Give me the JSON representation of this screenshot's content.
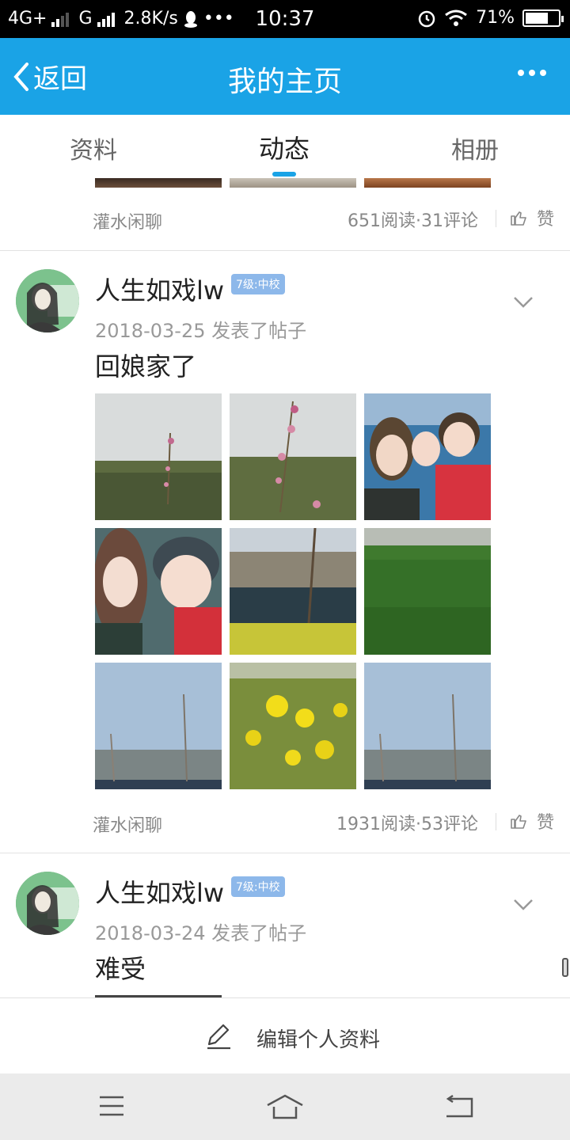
{
  "status_bar": {
    "network_1": "4G+",
    "network_2": "G",
    "speed": "2.8K/s",
    "overflow": "•••",
    "time": "10:37",
    "battery": "71%",
    "battery_level": 0.71,
    "icons": [
      "signal-icon",
      "qq-penguin-icon",
      "alarm-icon",
      "wifi-icon",
      "battery-icon"
    ]
  },
  "header": {
    "back_label": "返回",
    "title": "我的主页",
    "more_icon": "more-dots-icon"
  },
  "tabs": [
    {
      "label": "资料",
      "active": false
    },
    {
      "label": "动态",
      "active": true
    },
    {
      "label": "相册",
      "active": false
    }
  ],
  "feed": {
    "previous_post": {
      "category": "灌水闲聊",
      "stats": "651阅读·31评论",
      "like_label": "赞"
    },
    "posts": [
      {
        "author": "人生如戏lw",
        "level": "7级:中校",
        "date": "2018-03-25 发表了帖子",
        "text": "回娘家了",
        "images": [
          "magnolia-field",
          "magnolia-field",
          "selfie-family",
          "selfie-two",
          "river-trees",
          "green-field",
          "sky-trees",
          "rapeseed-flowers",
          "sky-trees"
        ],
        "category": "灌水闲聊",
        "stats": "1931阅读·53评论",
        "like_label": "赞"
      },
      {
        "author": "人生如戏lw",
        "level": "7级:中校",
        "date": "2018-03-24 发表了帖子",
        "text": "难受"
      }
    ]
  },
  "edit_bar": {
    "label": "编辑个人资料"
  },
  "nav_bar": {
    "icons": [
      "menu-icon",
      "home-icon",
      "back-nav-icon"
    ]
  },
  "colors": {
    "accent": "#1aa3e6",
    "level_badge": "#8db8ea"
  }
}
